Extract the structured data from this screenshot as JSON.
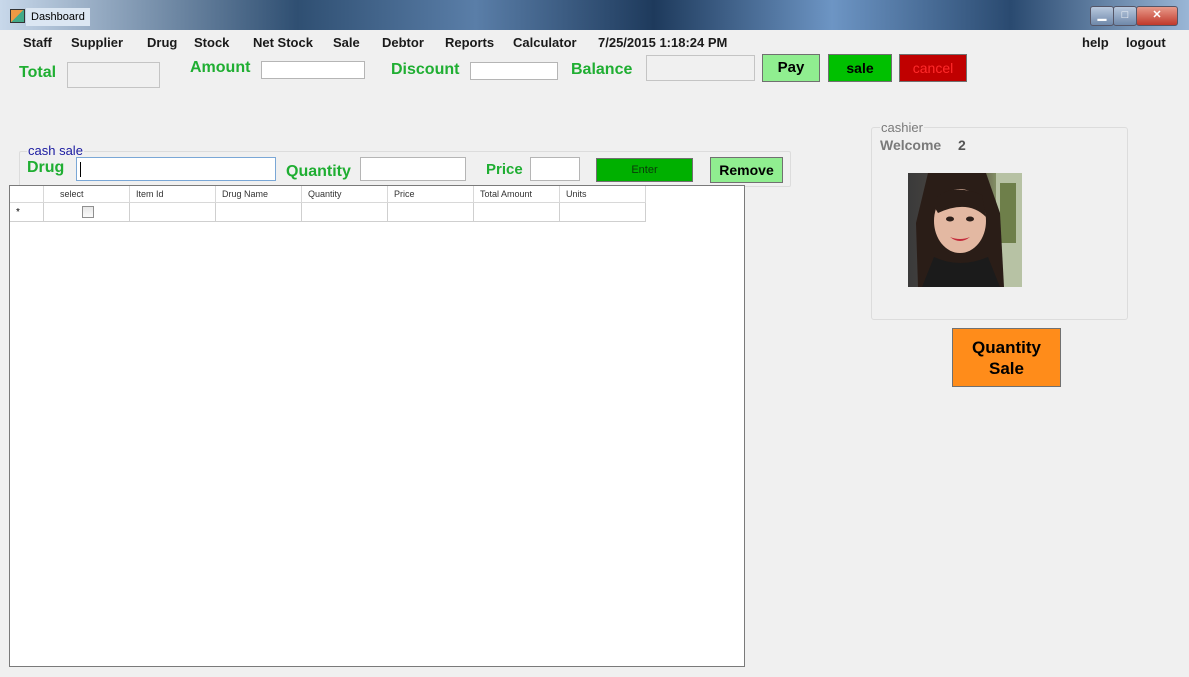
{
  "window": {
    "title": "Dashboard"
  },
  "menu": {
    "items": [
      "Staff",
      "Supplier",
      "Drug",
      "Stock",
      "Net Stock",
      "Sale",
      "Debtor",
      "Reports",
      "Calculator"
    ],
    "datetime": "7/25/2015 1:18:24 PM",
    "right_items": [
      "help",
      "logout"
    ]
  },
  "totals": {
    "total_label": "Total",
    "total_value": "",
    "amount_label": "Amount",
    "amount_value": "",
    "discount_label": "Discount",
    "discount_value": "",
    "balance_label": "Balance",
    "balance_value": ""
  },
  "actions": {
    "pay_label": "Pay",
    "sale_label": "sale",
    "cancel_label": "cancel"
  },
  "cash_sale": {
    "group_title": "cash sale",
    "drug_label": "Drug",
    "drug_value": "",
    "quantity_label": "Quantity",
    "quantity_value": "",
    "price_label": "Price",
    "price_value": "",
    "enter_label": "Enter",
    "remove_label": "Remove"
  },
  "grid": {
    "columns": [
      "select",
      "Item Id",
      "Drug Name",
      "Quantity",
      "Price",
      "Total Amount",
      "Units"
    ],
    "new_row_marker": "*",
    "rows": []
  },
  "cashier": {
    "group_title": "cashier",
    "welcome_label": "Welcome",
    "user_id": "2"
  },
  "quantity_sale": {
    "line1": "Quantity",
    "line2": "Sale"
  },
  "colors": {
    "green_label": "#1fae32",
    "pay_bg": "#90ee90",
    "sale_bg": "#00c000",
    "cancel_bg": "#c00000",
    "enter_bg": "#00b000",
    "remove_bg": "#90ee90",
    "quantity_sale_bg": "#ff8c1a",
    "cash_sale_title": "#1a1aa0"
  }
}
